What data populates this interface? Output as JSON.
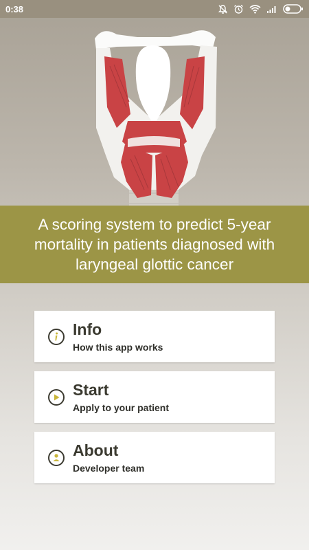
{
  "status_bar": {
    "time": "0:38",
    "icons": [
      "mute-bell-icon",
      "alarm-icon",
      "wifi-icon",
      "signal-icon",
      "battery-icon"
    ]
  },
  "banner": {
    "text": "A scoring system to predict 5-year mortality in patients diagnosed with laryngeal glottic cancer"
  },
  "menu": [
    {
      "title": "Info",
      "subtitle": "How this app works",
      "icon": "info-icon"
    },
    {
      "title": "Start",
      "subtitle": "Apply to your patient",
      "icon": "play-icon"
    },
    {
      "title": "About",
      "subtitle": "Developer team",
      "icon": "person-icon"
    }
  ],
  "colors": {
    "status_bar": "#99907f",
    "banner": "#9c9546",
    "accent": "#c9b63a",
    "icon_ring": "#3b3a30",
    "card_title": "#3b3a30"
  }
}
